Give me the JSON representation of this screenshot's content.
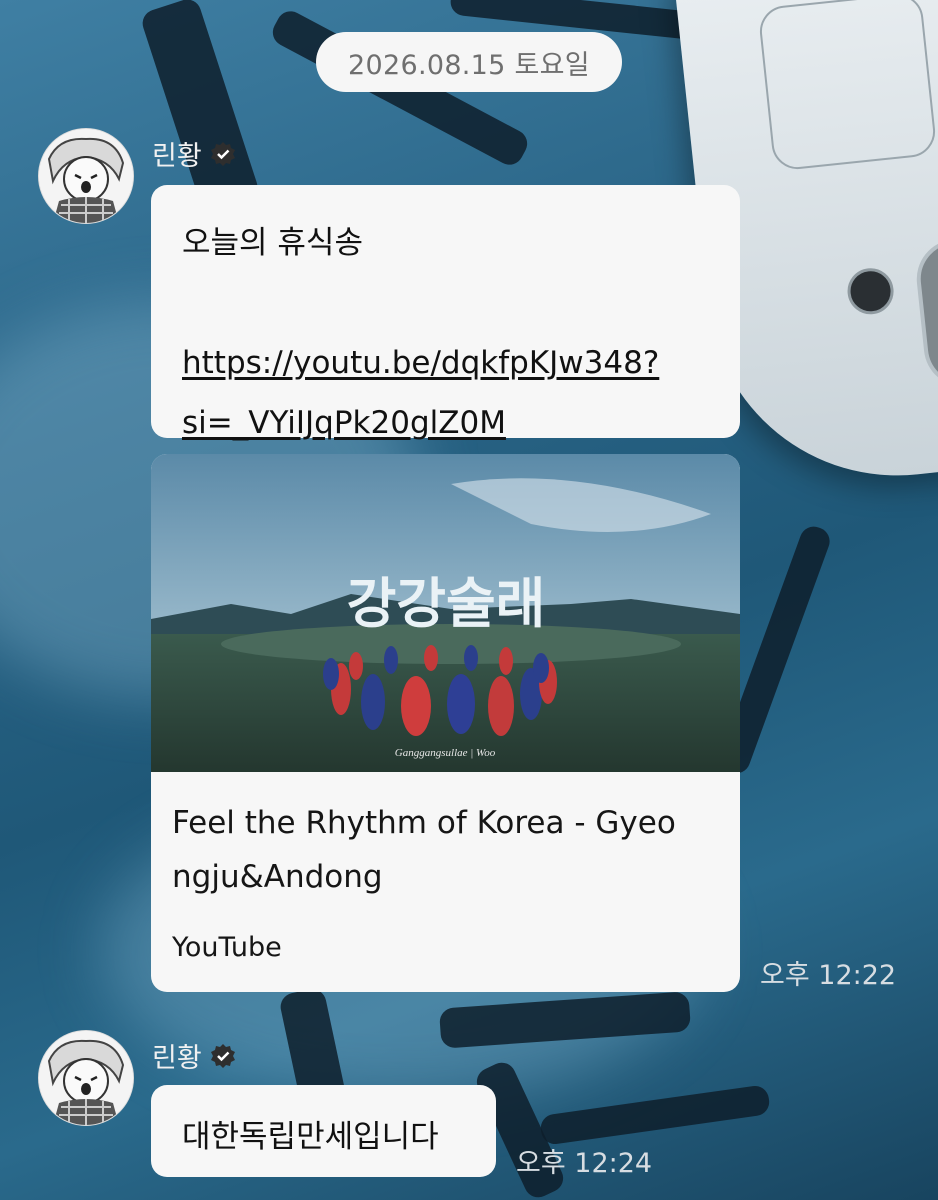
{
  "date_divider": "2026.08.15 토요일",
  "messages": [
    {
      "sender": "린황",
      "text": "오늘의 휴식송",
      "link": {
        "line1": "https://youtu.be/dqkfpKJw348?",
        "line2": "si=_VYiIJqPk20glZ0M"
      },
      "preview": {
        "thumbnail_title": "강강술래",
        "thumbnail_caption": "Ganggangsullae | Woo",
        "title_line1": "Feel the Rhythm of Korea - Gyeo",
        "title_line2": "ngju&Andong",
        "site": "YouTube"
      },
      "time": "오후 12:22"
    },
    {
      "sender": "린황",
      "text": "대한독립만세입니다",
      "time": "오후 12:24"
    }
  ],
  "icons": {
    "verified": "verified-badge-icon",
    "avatar": "avatar"
  },
  "colors": {
    "bubble": "#f7f7f7",
    "date_pill": "#f6f6f6",
    "background": "#2b6688"
  }
}
